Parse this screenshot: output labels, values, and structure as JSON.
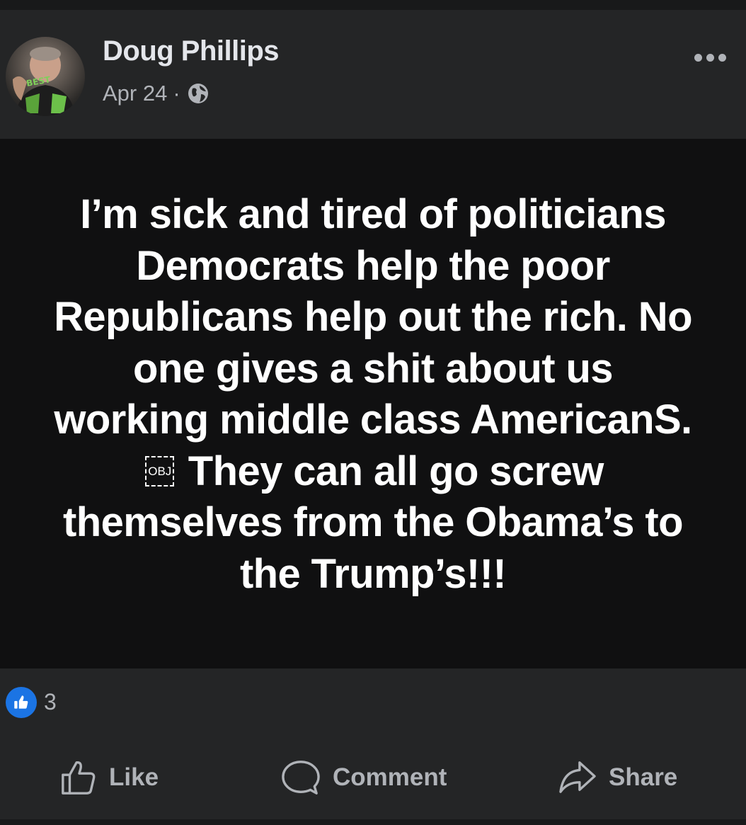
{
  "post": {
    "author": "Doug Phillips",
    "date": "Apr 24",
    "separator": "·",
    "privacy_icon": "globe-icon",
    "text": "I’m sick and tired of politicians Democrats help the poor\nRepublicans help out the rich. No one gives a shit about us\nworking middle class AmericanS.",
    "obj_placeholder": "OBJ",
    "text_after": " They can all go screw themselves from the Obama’s to the Trump’s!!!",
    "reaction_count": "3",
    "reaction_icon": "like-icon"
  },
  "actions": {
    "like_label": "Like",
    "comment_label": "Comment",
    "share_label": "Share"
  },
  "colors": {
    "accent": "#1b74e4",
    "card": "#242526",
    "text_primary": "#e4e6eb",
    "text_secondary": "#b0b3b8"
  }
}
